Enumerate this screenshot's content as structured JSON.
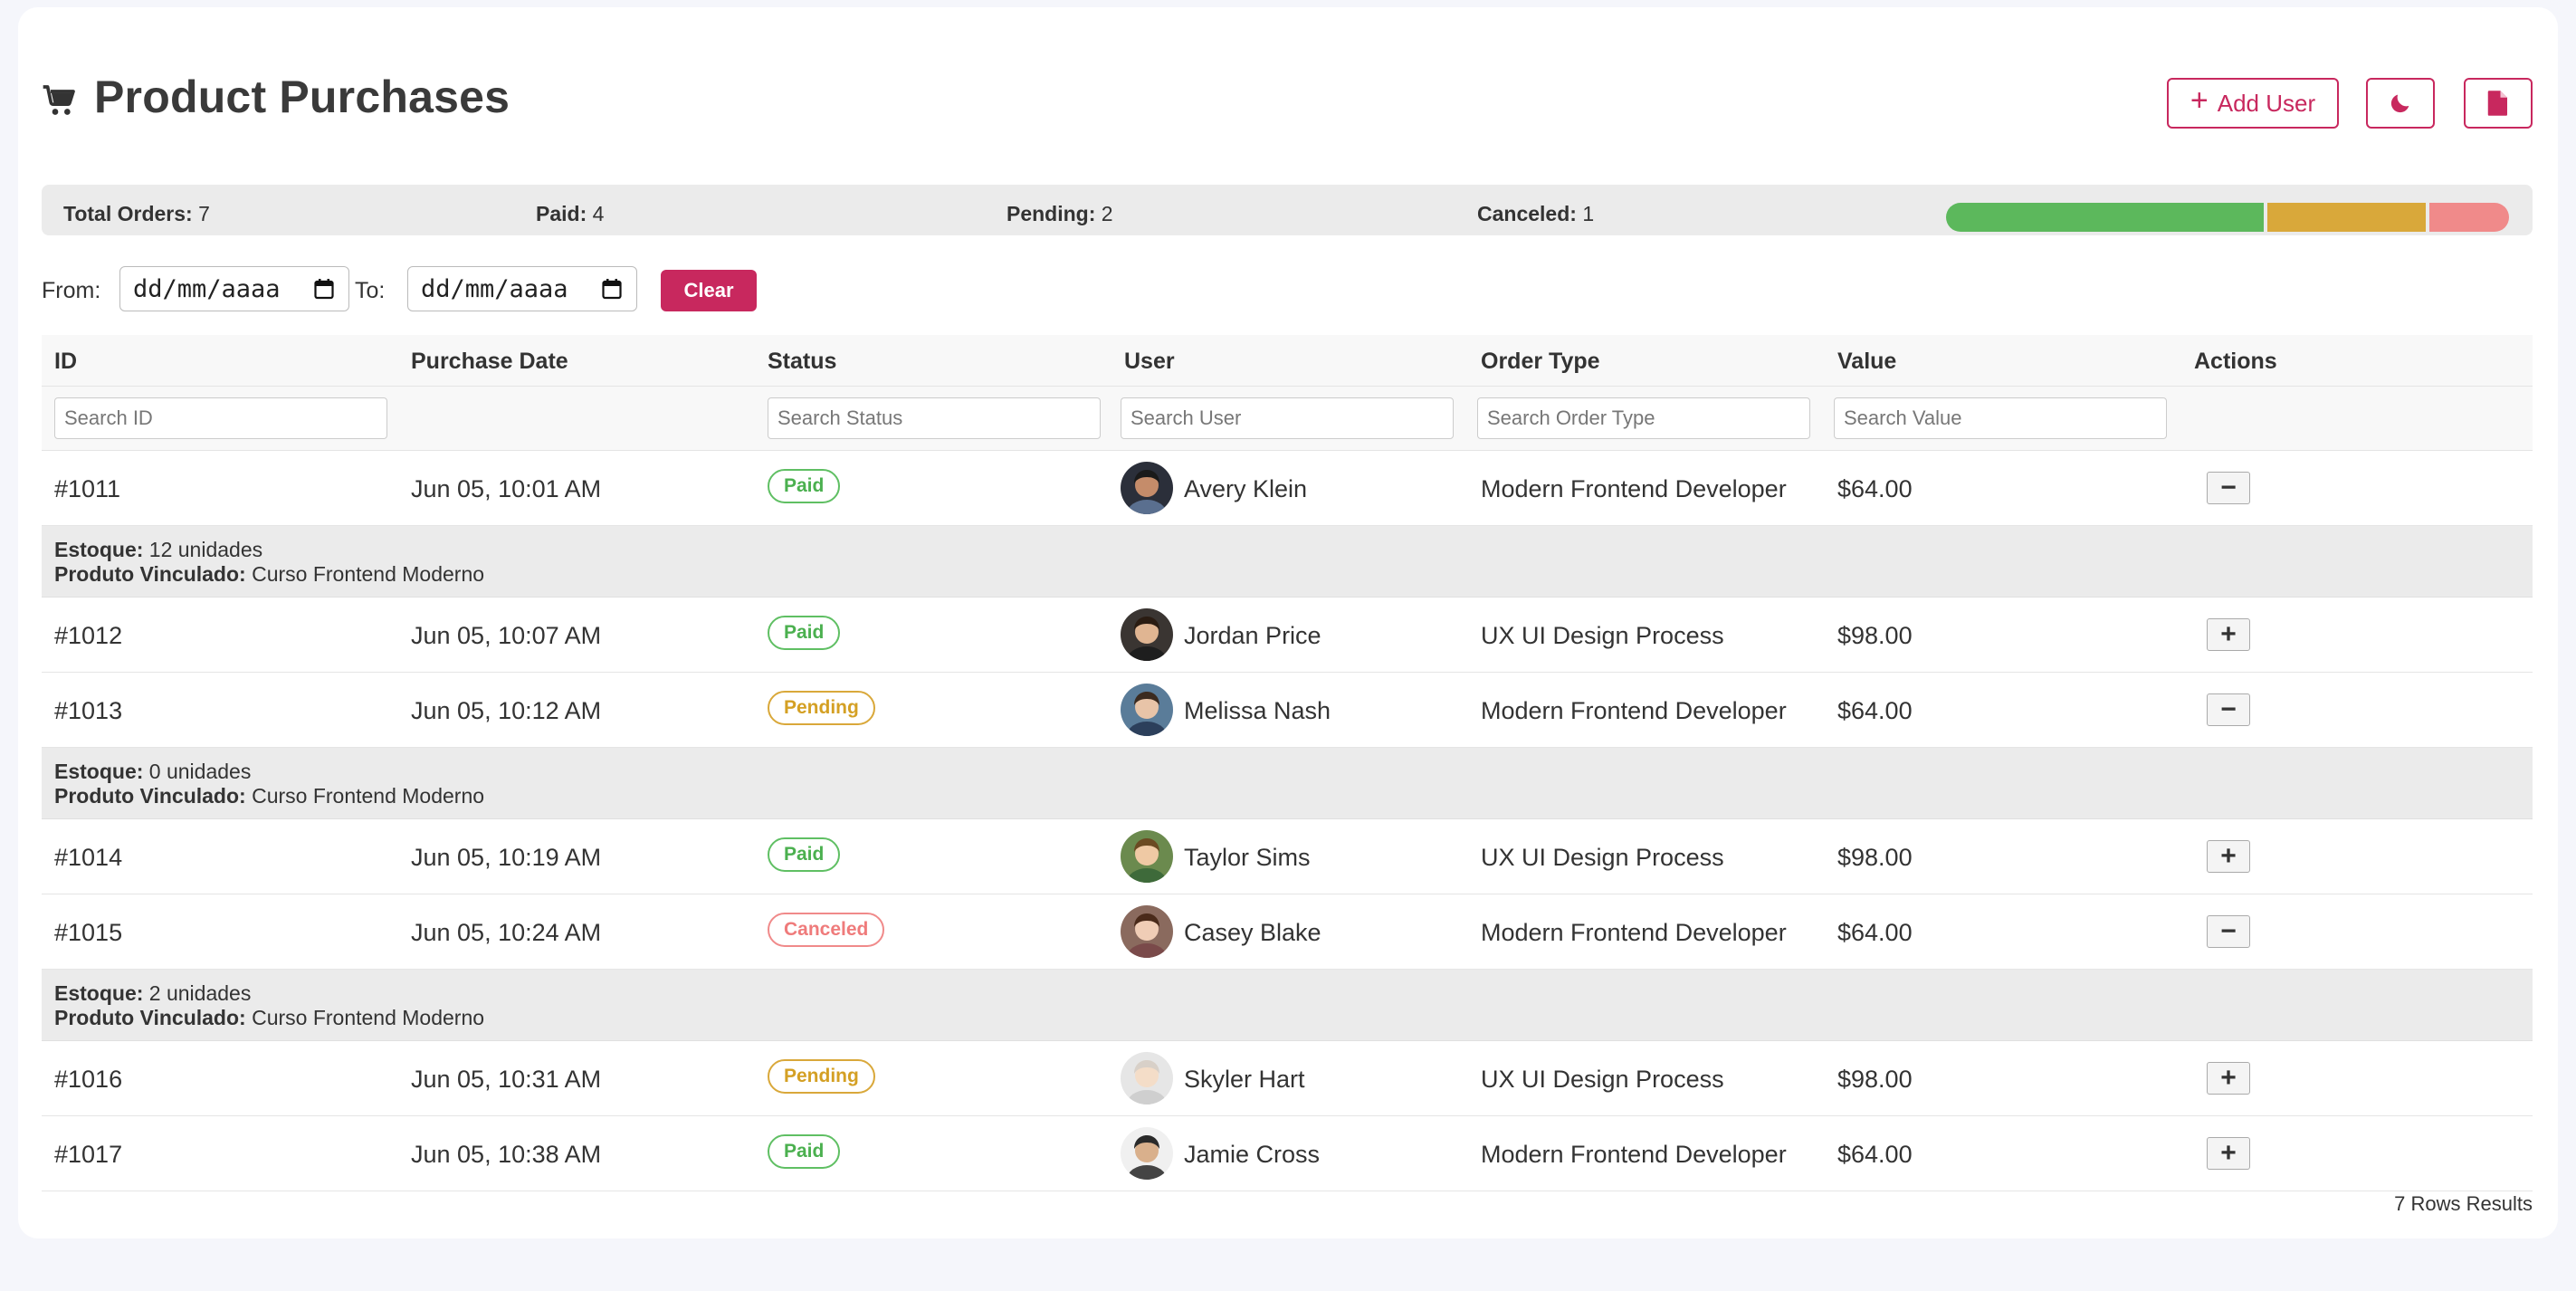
{
  "header": {
    "title": "Product Purchases",
    "add_user_label": "Add User",
    "accent": "#c8285e"
  },
  "summary": {
    "total_label": "Total Orders:",
    "total_value": "7",
    "paid_label": "Paid:",
    "paid_value": "4",
    "pending_label": "Pending:",
    "pending_value": "2",
    "canceled_label": "Canceled:",
    "canceled_value": "1",
    "progress": [
      {
        "status": "Paid",
        "fraction": 0.5714,
        "color": "#5cb85c"
      },
      {
        "status": "Pending",
        "fraction": 0.2857,
        "color": "#d9a83a"
      },
      {
        "status": "Canceled",
        "fraction": 0.1429,
        "color": "#f08a8a"
      }
    ]
  },
  "filters": {
    "from_label": "From:",
    "to_label": "To:",
    "from_value": "dd/mm/aaaa",
    "to_value": "dd/mm/aaaa",
    "clear_label": "Clear"
  },
  "table": {
    "columns": [
      "ID",
      "Purchase Date",
      "Status",
      "User",
      "Order Type",
      "Value",
      "Actions"
    ],
    "search_placeholders": {
      "id": "Search ID",
      "status": "Search Status",
      "user": "Search User",
      "order_type": "Search Order Type",
      "value": "Search Value"
    },
    "rows": [
      {
        "id": "#1011",
        "date": "Jun 05, 10:01 AM",
        "status": "Paid",
        "user": "Avery Klein",
        "order_type": "Modern Frontend Developer",
        "value": "$64.00",
        "action": "−"
      },
      {
        "id": "#1012",
        "date": "Jun 05, 10:07 AM",
        "status": "Paid",
        "user": "Jordan Price",
        "order_type": "UX UI Design Process",
        "value": "$98.00",
        "action": "+"
      },
      {
        "id": "#1013",
        "date": "Jun 05, 10:12 AM",
        "status": "Pending",
        "user": "Melissa Nash",
        "order_type": "Modern Frontend Developer",
        "value": "$64.00",
        "action": "−"
      },
      {
        "id": "#1014",
        "date": "Jun 05, 10:19 AM",
        "status": "Paid",
        "user": "Taylor Sims",
        "order_type": "UX UI Design Process",
        "value": "$98.00",
        "action": "+"
      },
      {
        "id": "#1015",
        "date": "Jun 05, 10:24 AM",
        "status": "Canceled",
        "user": "Casey Blake",
        "order_type": "Modern Frontend Developer",
        "value": "$64.00",
        "action": "−"
      },
      {
        "id": "#1016",
        "date": "Jun 05, 10:31 AM",
        "status": "Pending",
        "user": "Skyler Hart",
        "order_type": "UX UI Design Process",
        "value": "$98.00",
        "action": "+"
      },
      {
        "id": "#1017",
        "date": "Jun 05, 10:38 AM",
        "status": "Paid",
        "user": "Jamie Cross",
        "order_type": "Modern Frontend Developer",
        "value": "$64.00",
        "action": "+"
      }
    ],
    "details": [
      {
        "stock_label": "Estoque:",
        "stock_value": "12 unidades",
        "product_label": "Produto Vinculado:",
        "product_value": "Curso Frontend Moderno"
      },
      {
        "stock_label": "Estoque:",
        "stock_value": "0 unidades",
        "product_label": "Produto Vinculado:",
        "product_value": "Curso Frontend Moderno"
      },
      {
        "stock_label": "Estoque:",
        "stock_value": "2 unidades",
        "product_label": "Produto Vinculado:",
        "product_value": "Curso Frontend Moderno"
      }
    ],
    "footer": "7 Rows Results"
  }
}
